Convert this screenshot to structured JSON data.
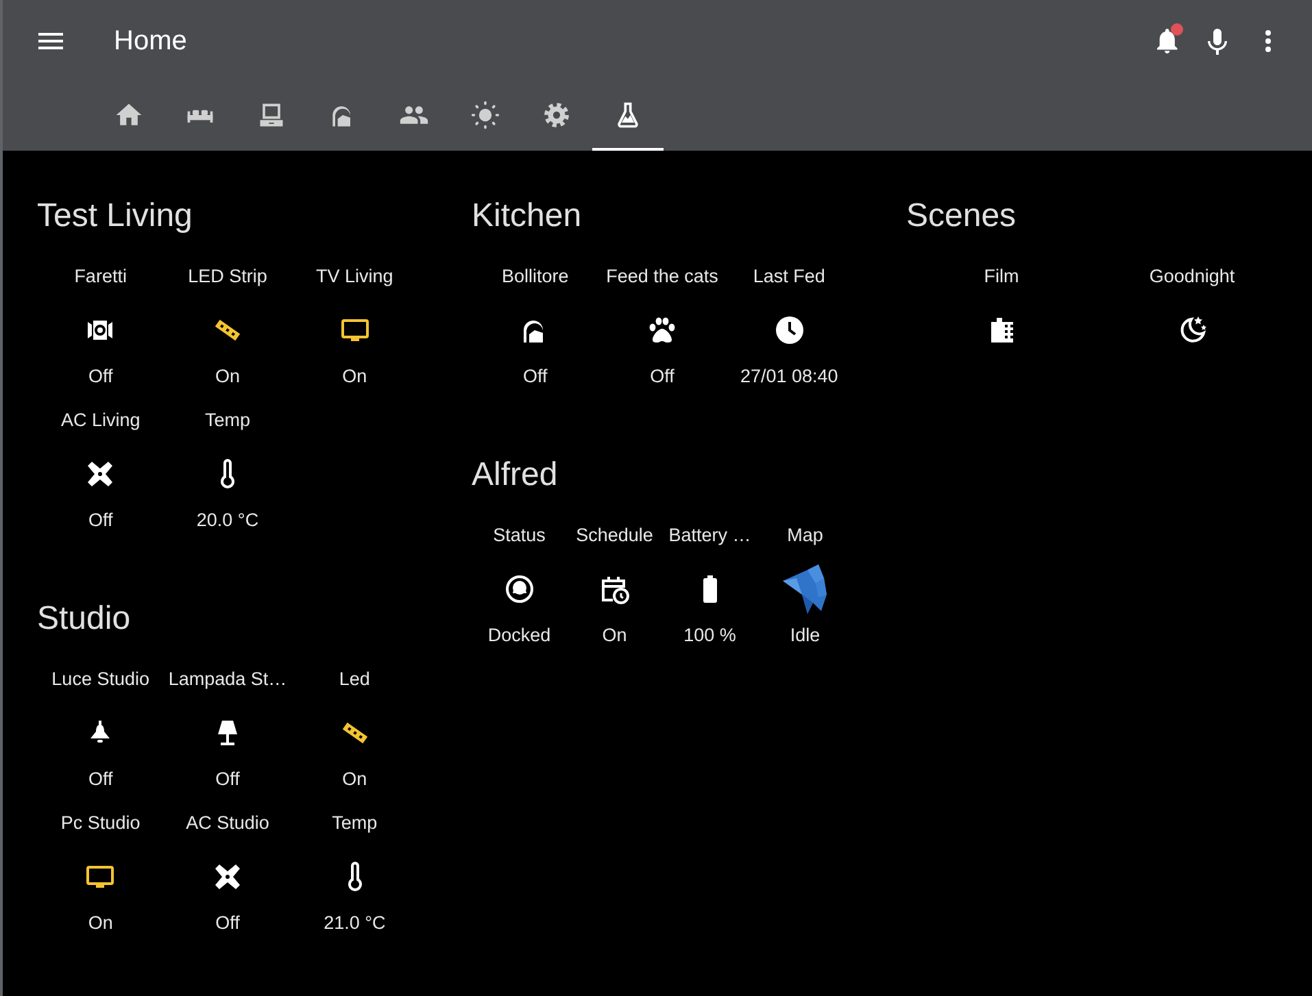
{
  "header": {
    "title": "Home",
    "notification_badge": true
  },
  "tabs": [
    {
      "kind": "home",
      "selected": false
    },
    {
      "kind": "bed",
      "selected": false
    },
    {
      "kind": "computer",
      "selected": false
    },
    {
      "kind": "kettle",
      "selected": false
    },
    {
      "kind": "people",
      "selected": false
    },
    {
      "kind": "sun",
      "selected": false
    },
    {
      "kind": "gear",
      "selected": false
    },
    {
      "kind": "flask",
      "selected": true
    }
  ],
  "columns": [
    {
      "cards": [
        {
          "title": "Test Living",
          "entities": [
            {
              "name": "Faretti",
              "kind": "spotlight",
              "on": false,
              "state": "Off"
            },
            {
              "name": "LED Strip",
              "kind": "led-strip",
              "on": true,
              "state": "On"
            },
            {
              "name": "TV Living",
              "kind": "tv",
              "on": true,
              "state": "On"
            },
            {
              "name": "AC Living",
              "kind": "fan",
              "on": false,
              "state": "Off"
            },
            {
              "name": "Temp",
              "kind": "thermometer",
              "state": "20.0 °C"
            }
          ]
        },
        {
          "title": "Studio",
          "entities": [
            {
              "name": "Luce Studio",
              "kind": "ceiling-light",
              "on": false,
              "state": "Off"
            },
            {
              "name": "Lampada St…",
              "kind": "lamp",
              "on": false,
              "state": "Off"
            },
            {
              "name": "Led",
              "kind": "led-strip",
              "on": true,
              "state": "On"
            },
            {
              "name": "Pc Studio",
              "kind": "tv",
              "on": true,
              "state": "On"
            },
            {
              "name": "AC Studio",
              "kind": "fan",
              "on": false,
              "state": "Off"
            },
            {
              "name": "Temp",
              "kind": "thermometer",
              "state": "21.0 °C"
            }
          ]
        }
      ]
    },
    {
      "cards": [
        {
          "title": "Kitchen",
          "entities": [
            {
              "name": "Bollitore",
              "kind": "kettle",
              "on": false,
              "state": "Off"
            },
            {
              "name": "Feed the cats",
              "kind": "paw",
              "on": false,
              "state": "Off"
            },
            {
              "name": "Last Fed",
              "kind": "clock",
              "state": "27/01 08:40"
            }
          ]
        },
        {
          "title": "Alfred",
          "entities": [
            {
              "name": "Status",
              "kind": "vacuum",
              "state": "Docked"
            },
            {
              "name": "Schedule",
              "kind": "calendar",
              "state": "On"
            },
            {
              "name": "Battery …",
              "kind": "battery",
              "state": "100 %"
            },
            {
              "name": "Map",
              "kind": "map",
              "state": "Idle"
            }
          ]
        }
      ]
    },
    {
      "cards": [
        {
          "title": "Scenes",
          "entities": [
            {
              "name": "Film",
              "kind": "film"
            },
            {
              "name": "Goodnight",
              "kind": "moon"
            }
          ]
        }
      ]
    }
  ]
}
